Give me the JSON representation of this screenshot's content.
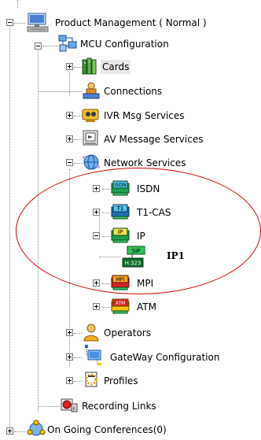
{
  "tree": {
    "root": {
      "label": "Product Management  ( Normal )",
      "icon": "monitor-icon"
    },
    "mcu": {
      "label": "MCU Configuration",
      "icon": "network-blocks-icon"
    },
    "cards": {
      "label": "Cards",
      "icon": "cards-icon"
    },
    "connections": {
      "label": "Connections",
      "icon": "connections-icon"
    },
    "ivr": {
      "label": "IVR Msg Services",
      "icon": "ivr-icon"
    },
    "av": {
      "label": "AV Message Services",
      "icon": "av-message-icon"
    },
    "network": {
      "label": "Network Services",
      "icon": "globe-icon"
    },
    "isdn": {
      "label": "ISDN",
      "icon": "isdn-icon",
      "badge": "ISDN"
    },
    "t1cas": {
      "label": "T1-CAS",
      "icon": "t1-icon",
      "badge": "T1"
    },
    "ip": {
      "label": "IP",
      "icon": "ip-icon",
      "badge": "IP"
    },
    "ip1": {
      "label": "IP1",
      "icon": "sip-h323-icon",
      "badge_top": "SIP",
      "badge_bottom": "H.323"
    },
    "mpi": {
      "label": "MPI",
      "icon": "mpi-icon",
      "badge": "MPI"
    },
    "atm": {
      "label": "ATM",
      "icon": "atm-icon",
      "badge": "ATM"
    },
    "operators": {
      "label": "Operators",
      "icon": "operators-icon"
    },
    "gateway": {
      "label": "GateWay Configuration",
      "icon": "gateway-icon"
    },
    "profiles": {
      "label": "Profiles",
      "icon": "profiles-icon"
    },
    "recording": {
      "label": "Recording Links",
      "icon": "recording-icon"
    },
    "ongoing": {
      "label": "On Going Conferences(0)",
      "icon": "conferences-icon"
    }
  },
  "colors": {
    "highlight_ellipse": "#d40000",
    "selected_bg": "#e8e8e8",
    "badge_green": "#1f9e4f",
    "badge_red": "#d82020",
    "badge_yellow": "#f1c500"
  }
}
